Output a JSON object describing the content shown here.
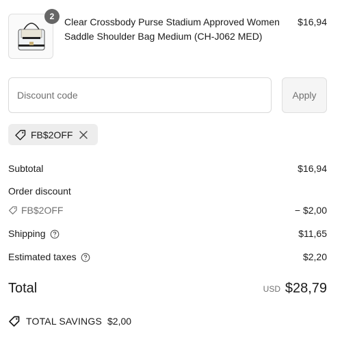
{
  "product": {
    "title": "Clear Crossbody Purse Stadium Approved Women Saddle Shoulder Bag Medium (CH-J062 MED)",
    "quantity": "2",
    "price": "$16,94"
  },
  "discount": {
    "placeholder": "Discount code",
    "apply_label": "Apply",
    "applied_code": "FB$2OFF"
  },
  "summary": {
    "subtotal_label": "Subtotal",
    "subtotal_value": "$16,94",
    "order_discount_label": "Order discount",
    "order_discount_code": "FB$2OFF",
    "order_discount_value": "− $2,00",
    "shipping_label": "Shipping",
    "shipping_value": "$11,65",
    "taxes_label": "Estimated taxes",
    "taxes_value": "$2,20",
    "total_label": "Total",
    "total_currency": "USD",
    "total_value": "$28,79",
    "savings_label": "TOTAL SAVINGS",
    "savings_value": "$2,00"
  },
  "colors": {
    "text": "#1a1a1a",
    "muted": "#707070",
    "badge": "#666666",
    "chip": "#ededed",
    "border": "#d9d9d9"
  },
  "icons": [
    "tag-icon",
    "close-icon",
    "help-icon",
    "tag-icon",
    "savings-tag-icon"
  ]
}
